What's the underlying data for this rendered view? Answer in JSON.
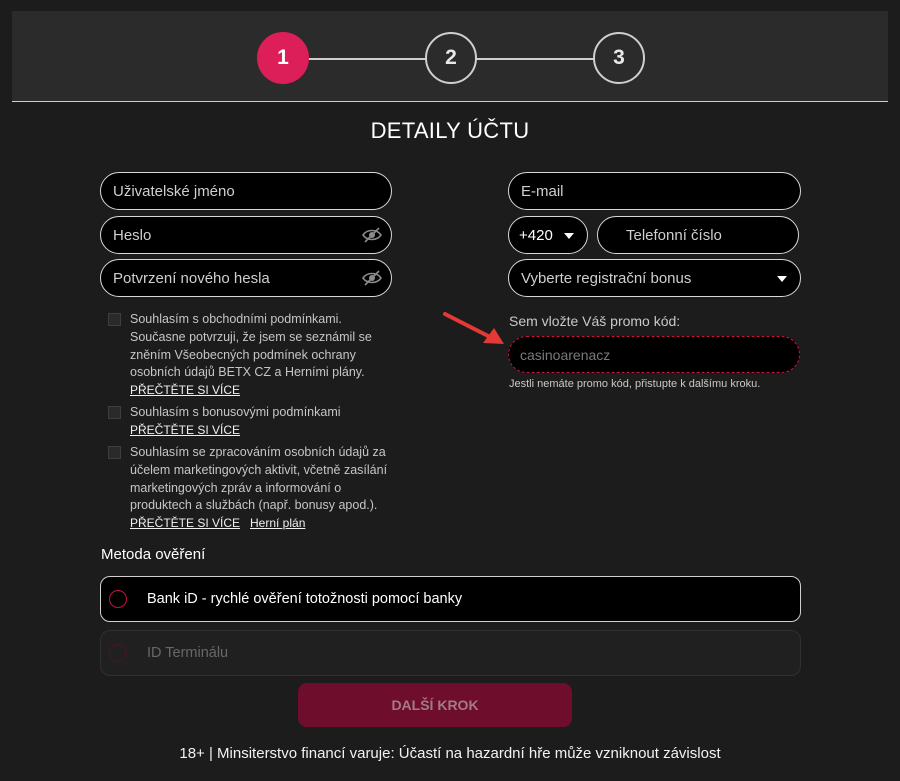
{
  "steps": [
    "1",
    "2",
    "3"
  ],
  "title": "DETAILY ÚČTU",
  "fields": {
    "username": "Uživatelské jméno",
    "password": "Heslo",
    "password_confirm": "Potvrzení nového hesla",
    "email": "E-mail",
    "phone_prefix": "+420",
    "phone": "Telefonní číslo",
    "bonus_select": "Vyberte registrační bonus"
  },
  "consents": [
    {
      "text": "Souhlasím s obchodními podmínkami. Současne potvrzuji, že jsem se seznámil se zněním Všeobecných podmínek ochrany osobních údajů BETX CZ a Herními plány.",
      "link": "PŘEČTĚTE SI VÍCE"
    },
    {
      "text": "Souhlasím s bonusovými podmínkami",
      "link": "PŘEČTĚTE SI VÍCE"
    },
    {
      "text": "Souhlasím se zpracováním osobních údajů za účelem marketingových aktivit, včetně zasílání marketingových zpráv a informování o produktech a službách (např. bonusy apod.).",
      "link": "PŘEČTĚTE SI VÍCE",
      "link2": "Herní plán"
    }
  ],
  "promo": {
    "label": "Sem vložte Váš promo kód:",
    "value": "casinoarenacz",
    "hint": "Jestli nemáte promo kód, přistupte k dalšímu kroku."
  },
  "verification": {
    "label": "Metoda ověření",
    "methods": [
      "Bank iD - rychlé ověření totožnosti pomocí banky",
      "ID Terminálu"
    ]
  },
  "next_label": "DALŠÍ KROK",
  "warning": "18+ | Minsiterstvo financí varuje: Účastí na hazardní hře může vzniknout závislost",
  "colors": {
    "accent": "#dc1f58",
    "promo_border": "#c0163f",
    "arrow": "#e53935",
    "background": "#1c1c1c"
  }
}
